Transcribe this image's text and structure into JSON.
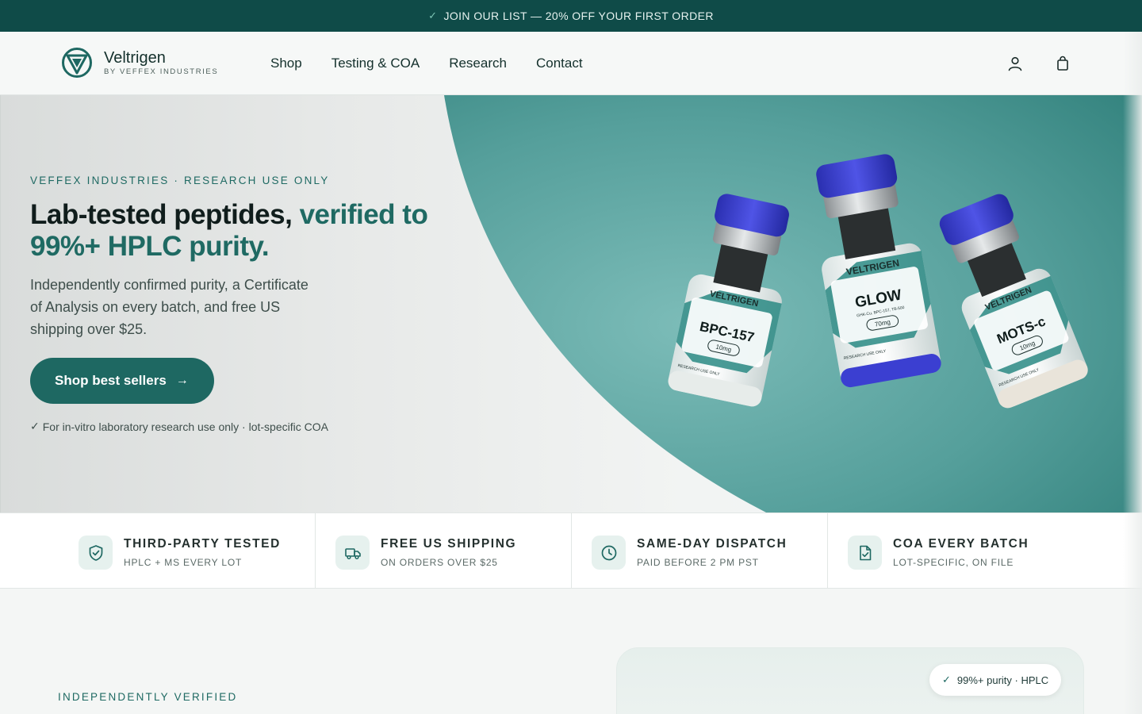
{
  "announcement": {
    "text": "JOIN OUR LIST — 20% OFF YOUR FIRST ORDER",
    "icon": "check-icon"
  },
  "brand": {
    "name": "Veltrigen",
    "byline": "BY VEFFEX INDUSTRIES"
  },
  "nav": {
    "items": [
      "Shop",
      "Testing & COA",
      "Research",
      "Contact"
    ]
  },
  "header_icons": [
    "user-icon",
    "shopping-bag-icon"
  ],
  "hero": {
    "eyebrow": "VEFFEX INDUSTRIES · RESEARCH USE ONLY",
    "headline_plain": "Lab-tested peptides, ",
    "headline_accent": "verified to 99%+ HPLC purity.",
    "lede": "Independently confirmed purity, a Certificate of Analysis on every batch, and free US shipping over $25.",
    "cta_label": "Shop best sellers",
    "note": "For in-vitro laboratory research use only · lot-specific COA",
    "vials": [
      {
        "brand": "VELTRIGEN",
        "name": "BPC-157",
        "dose": "10mg",
        "footer": "RESEARCH USE ONLY",
        "cap_color": "#3b3fd1"
      },
      {
        "brand": "VELTRIGEN",
        "name": "GLOW",
        "sub": "GHK-Cu, BPC-157, TB-500",
        "dose": "70mg",
        "footer": "RESEARCH USE ONLY",
        "cap_color": "#3b3fd1"
      },
      {
        "brand": "VELTRIGEN",
        "name": "MOTS-c",
        "dose": "10mg",
        "footer": "RESEARCH USE ONLY",
        "cap_color": "#3b3fd1"
      }
    ]
  },
  "features": [
    {
      "icon": "shield-check-icon",
      "title": "THIRD-PARTY TESTED",
      "desc": "HPLC + MS EVERY LOT"
    },
    {
      "icon": "truck-icon",
      "title": "FREE US SHIPPING",
      "desc": "ON ORDERS OVER $25"
    },
    {
      "icon": "clock-icon",
      "title": "SAME-DAY DISPATCH",
      "desc": "PAID BEFORE 2 PM PST"
    },
    {
      "icon": "document-check-icon",
      "title": "COA EVERY BATCH",
      "desc": "LOT-SPECIFIC, ON FILE"
    }
  ],
  "lower": {
    "eyebrow": "INDEPENDENTLY VERIFIED",
    "purity_badge": "99%+ purity · HPLC"
  },
  "colors": {
    "primary": "#1e6862",
    "announcement_bg": "#0f4b48",
    "hero_teal": "#4e9f9b",
    "cap_blue": "#3b3fd1"
  }
}
